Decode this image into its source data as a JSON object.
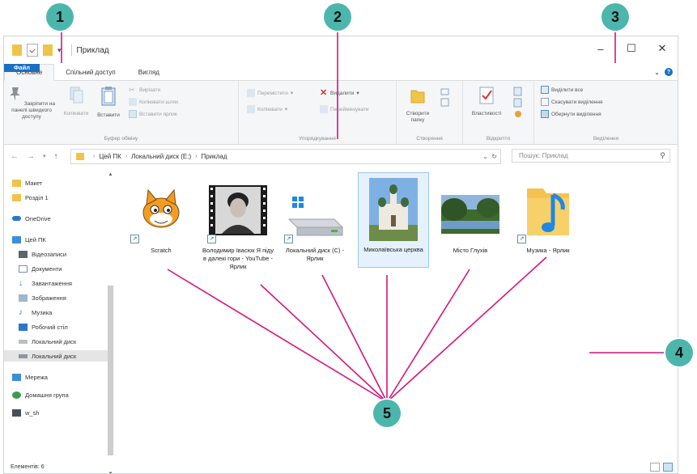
{
  "callouts": [
    "1",
    "2",
    "3",
    "4",
    "5"
  ],
  "window": {
    "title": "Приклад",
    "controls": [
      "–",
      "☐",
      "✕"
    ]
  },
  "menubar": {
    "file": "Файл",
    "tabs": [
      "Основне",
      "Спільний доступ",
      "Вигляд"
    ],
    "expand": "⌄",
    "help": "?"
  },
  "ribbon": {
    "clipboard": {
      "label": "Буфер обміну",
      "pin": "Закріпити на панелі швидкого доступу",
      "copy": "Копіювати",
      "paste": "Вставити",
      "cut": "Вирізати",
      "copy_path": "Копіювати шлях",
      "paste_shortcut": "Вставити ярлик"
    },
    "organize": {
      "label": "Упорядкування",
      "move_to": "Перемістити",
      "copy_to": "Копіювати",
      "delete": "Видалити",
      "rename": "Перейменувати"
    },
    "new": {
      "label": "Створення",
      "new_folder": "Створити папку"
    },
    "open": {
      "label": "Відкриття",
      "properties": "Властивості"
    },
    "select": {
      "label": "Виділення",
      "select_all": "Виділити все",
      "select_none": "Скасувати виділення",
      "invert": "Обернути виділення"
    }
  },
  "address": {
    "path": [
      "Цей ПК",
      "Локальний диск (E:)",
      "Приклад"
    ],
    "search_placeholder": "Пошук: Приклад"
  },
  "nav": {
    "items": [
      {
        "label": "Макет",
        "icon": "folder-icon"
      },
      {
        "label": "Розділ 1",
        "icon": "folder-icon"
      },
      {
        "label": "OneDrive",
        "icon": "cloud-icon"
      },
      {
        "label": "Цей ПК",
        "icon": "computer-icon"
      },
      {
        "label": "Відеозаписи",
        "icon": "video-icon"
      },
      {
        "label": "Документи",
        "icon": "document-icon"
      },
      {
        "label": "Завантаження",
        "icon": "download-icon"
      },
      {
        "label": "Зображення",
        "icon": "image-icon"
      },
      {
        "label": "Музика",
        "icon": "music-icon"
      },
      {
        "label": "Робочий стіл",
        "icon": "desktop-icon"
      },
      {
        "label": "Локальний диск",
        "icon": "drive-icon"
      },
      {
        "label": "Локальний диск",
        "icon": "drive-icon"
      },
      {
        "label": "Мережа",
        "icon": "network-icon"
      },
      {
        "label": "Домашня група",
        "icon": "homegroup-icon"
      },
      {
        "label": "w_sh",
        "icon": "user-icon"
      }
    ]
  },
  "files": [
    {
      "label": "Scratch",
      "icon": "scratch-cat-icon",
      "shortcut": true
    },
    {
      "label": "Володимир Івасюк Я піду в далекі гори - YouTube - Ярлик",
      "icon": "video-thumbnail-icon",
      "shortcut": true
    },
    {
      "label": "Локальний диск (С) - Ярлик",
      "icon": "drive-icon",
      "shortcut": true
    },
    {
      "label": "Миколаївська церква",
      "icon": "church-photo-icon",
      "shortcut": false
    },
    {
      "label": "Місто Глухів",
      "icon": "landscape-photo-icon",
      "shortcut": false
    },
    {
      "label": "Музика - Ярлик",
      "icon": "music-folder-icon",
      "shortcut": true
    }
  ],
  "status": {
    "text": "Елементів: 6"
  },
  "colors": {
    "callout": "#4db6ac",
    "pointer_lines": "#d6147f",
    "file_tab": "#1a6fc2"
  }
}
